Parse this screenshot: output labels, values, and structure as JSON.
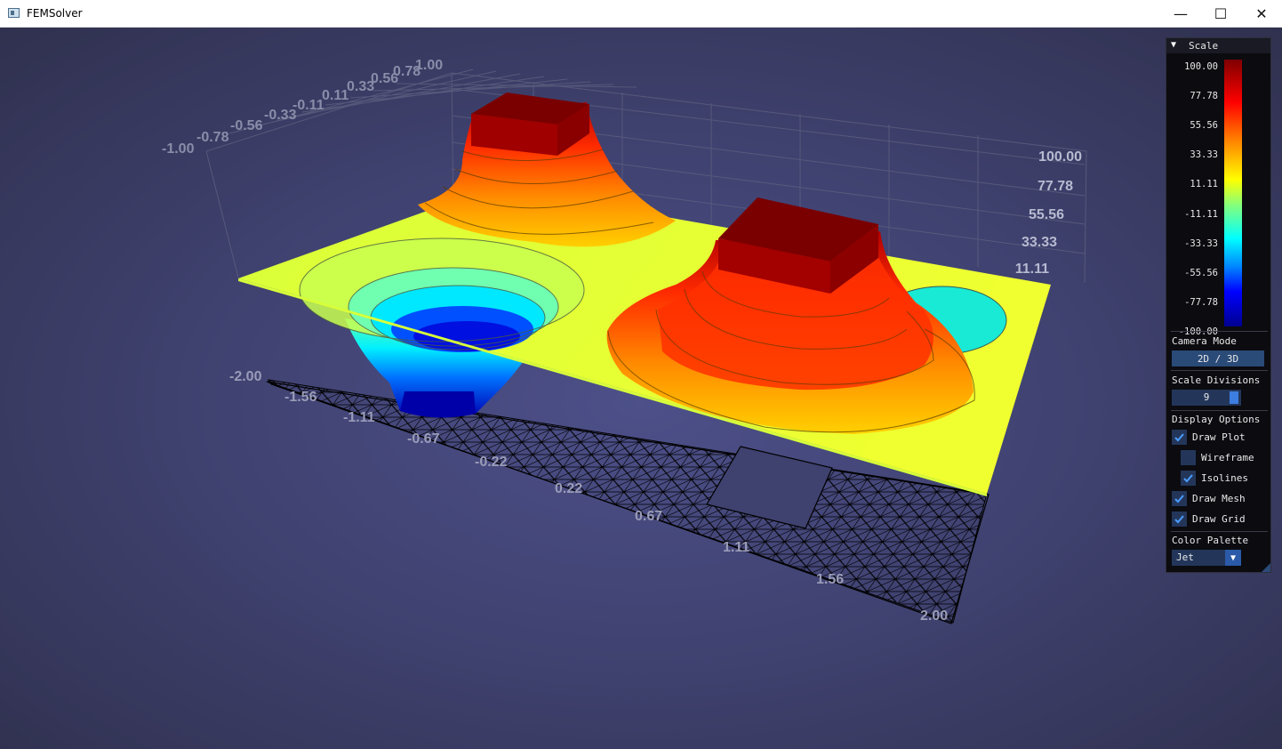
{
  "window": {
    "title": "FEMSolver",
    "minimize": "—",
    "maximize": "☐",
    "close": "✕"
  },
  "axes": {
    "y_ticks": [
      "-1.00",
      "-0.78",
      "-0.56",
      "-0.33",
      "-0.11",
      "0.11",
      "0.33",
      "0.56",
      "0.78",
      "1.00"
    ],
    "z_ticks": [
      "100.00",
      "77.78",
      "55.56",
      "33.33",
      "11.11"
    ],
    "x_ticks": [
      "-2.00",
      "-1.56",
      "-1.11",
      "-0.67",
      "-0.22",
      "0.22",
      "0.67",
      "1.11",
      "1.56",
      "2.00"
    ]
  },
  "panel": {
    "title": "Scale",
    "scale_values": [
      "100.00",
      "77.78",
      "55.56",
      "33.33",
      "11.11",
      "-11.11",
      "-33.33",
      "-55.56",
      "-77.78",
      "-100.00"
    ],
    "camera_mode_label": "Camera Mode",
    "camera_mode_button": "2D / 3D",
    "scale_divisions_label": "Scale Divisions",
    "scale_divisions_value": "9",
    "display_options_label": "Display Options",
    "options": [
      {
        "label": "Draw Plot",
        "checked": true
      },
      {
        "label": "Wireframe",
        "checked": false
      },
      {
        "label": "Isolines",
        "checked": true
      },
      {
        "label": "Draw Mesh",
        "checked": true
      },
      {
        "label": "Draw Grid",
        "checked": true
      }
    ],
    "color_palette_label": "Color Palette",
    "color_palette_value": "Jet"
  },
  "colors": {
    "background": "#3d3f6b",
    "accent": "#2a4a78",
    "checkbox": "#23365a"
  }
}
